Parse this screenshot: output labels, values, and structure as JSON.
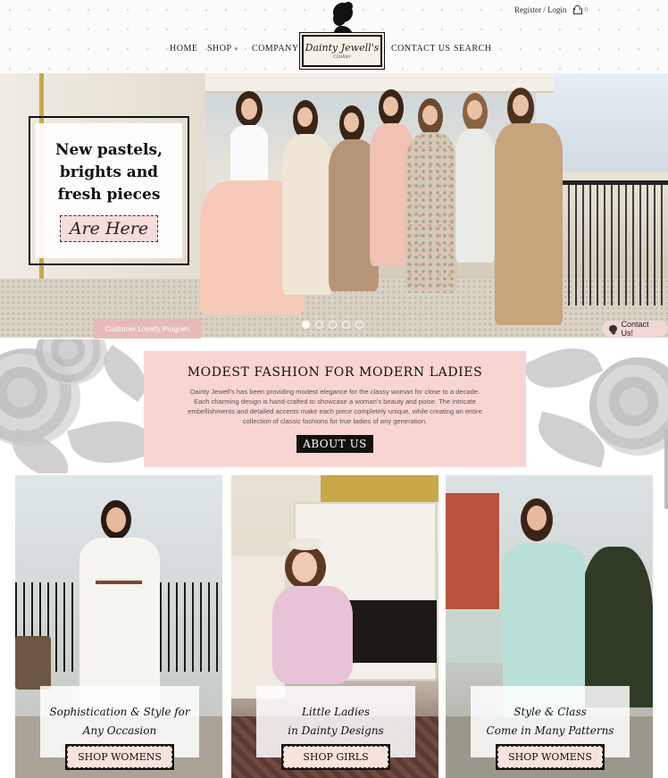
{
  "header": {
    "account_link": "Register / Login",
    "cart_count": "0",
    "nav": {
      "home": "HOME",
      "shop": "SHOP",
      "company": "COMPANY",
      "contact": "CONTACT US",
      "search": "SEARCH"
    },
    "logo": {
      "name": "Dainty Jewell's",
      "tagline": "Clothier"
    }
  },
  "hero": {
    "headline_line1": "New pastels,",
    "headline_line2": "brights and",
    "headline_line3": "fresh pieces",
    "cta": "Are Here",
    "loyalty_button": "Customer Loyalty Program",
    "slide_count": 5,
    "active_slide": 1,
    "contact_chip": "Contact Us!"
  },
  "about": {
    "title": "MODEST FASHION FOR MODERN LADIES",
    "body": "Dainty Jewell's has been providing modest elegance for the classy woman for close to a decade. Each charming design is hand-crafted to showcase a woman's beauty and poise. The intricate embellishments and detailed accents make each piece completely unique, while creating an entire collection of classic fashions for true ladies of any generation.",
    "button": "ABOUT US"
  },
  "cards": [
    {
      "caption_line1": "Sophistication & Style for",
      "caption_line2": "Any Occasion",
      "button": "SHOP WOMENS"
    },
    {
      "caption_line1": "Little Ladies",
      "caption_line2": "in Dainty Designs",
      "button": "SHOP GIRLS"
    },
    {
      "caption_line1": "Style & Class",
      "caption_line2": "Come in Many Patterns",
      "button": "SHOP WOMENS"
    }
  ],
  "colors": {
    "accent_pink": "#f8d5d3",
    "dark": "#111111",
    "loyalty_pink": "#e8b9b9"
  },
  "icons": [
    "cart-icon",
    "chat-icon",
    "chevron-down-icon"
  ]
}
